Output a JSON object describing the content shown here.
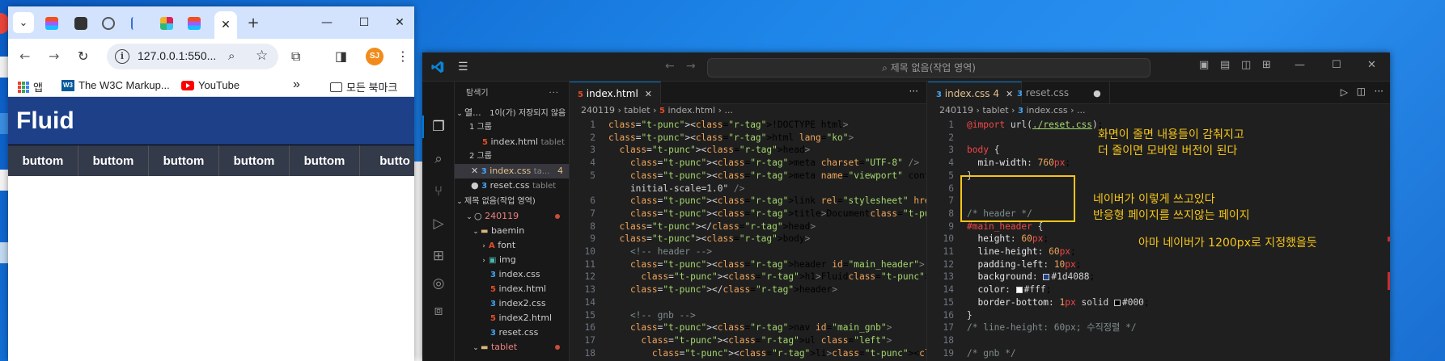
{
  "chrome": {
    "url": "127.0.0.1:550...",
    "avatar_initials": "SJ",
    "bookmarks": [
      "앱",
      "The W3C Markup...",
      "YouTube",
      "모든 북마크"
    ],
    "page": {
      "header_title": "Fluid",
      "nav_items": [
        "buttom",
        "buttom",
        "buttom",
        "buttom",
        "buttom",
        "butto"
      ]
    }
  },
  "vscode": {
    "command_center": "제목 없음(작업 영역)",
    "explorer": {
      "title": "탐색기",
      "open_editors_label": "열...",
      "unsaved": "1이(가) 저장되지 않음",
      "group1": "1 그룹",
      "group2": "2 그룹",
      "g1_file": "index.html",
      "g1_file_dir": "tablet",
      "g2_file1": "index.css",
      "g2_file1_dir": "ta...",
      "g2_file1_badge": "4",
      "g2_file2": "reset.css",
      "g2_file2_dir": "tablet",
      "workspace": "제목 없음(작업 영역)",
      "root": "240119",
      "folder_baemin": "baemin",
      "folder_font": "font",
      "folder_img": "img",
      "files": [
        "index.css",
        "index.html",
        "index2.css",
        "index2.html",
        "reset.css"
      ],
      "folder_tablet": "tablet"
    },
    "left_editor": {
      "tab": "index.html",
      "crumbs": [
        "240119",
        "tablet",
        "index.html",
        "..."
      ],
      "lines": [
        "<!DOCTYPE html>",
        "<html lang=\"ko\">",
        "  <head>",
        "    <meta charset=\"UTF-8\" />",
        "    <meta name=\"viewport\" content=\"width=device-width,",
        "    initial-scale=1.0\" />",
        "    <link rel=\"stylesheet\" href=\"./index.css\" />",
        "    <title>Document</title>",
        "  </head>",
        "  <body>",
        "    <!-- header -->",
        "    <header id=\"main_header\">",
        "      <h1>Fluid</h1>",
        "    </header>",
        "",
        "    <!-- gnb -->",
        "    <nav id=\"main_gnb\">",
        "      <ul class=\"left\">",
        "        <li><a href=\"#\">buttom</a></li>"
      ],
      "line_numbers": [
        "1",
        "2",
        "3",
        "4",
        "5",
        "",
        "6",
        "7",
        "8",
        "9",
        "10",
        "11",
        "12",
        "13",
        "14",
        "15",
        "16",
        "17",
        "18"
      ]
    },
    "right_editor": {
      "tab1": "index.css",
      "tab1_badge": "4",
      "tab2": "reset.css",
      "crumbs": [
        "240119",
        "tablet",
        "index.css",
        "..."
      ],
      "lines": [
        "@import url(./reset.css);",
        "",
        "body {",
        "  min-width: 760px;",
        "}",
        "",
        "",
        "/* header */",
        "#main_header {",
        "  height: 60px;",
        "  line-height: 60px;",
        "  padding-left: 10px;",
        "  background: #1d4088;",
        "  color: #fff;",
        "  border-bottom: 1px solid #000;",
        "}",
        "/* line-height: 60px; 수직정렬 */",
        "",
        "/* gnb */",
        "#main_gnb {"
      ]
    },
    "annotations": {
      "a1_line1": "화면이 줄면 내용들이 감춰지고",
      "a1_line2": "더 줄이면 모바일 버전이 된다",
      "a2_line1": "네이버가 이렇게 쓰고있다",
      "a2_line2": "반응형 페이지를 쓰지않는 페이지",
      "a3": "아마 네이버가 1200px로 지정했을듯"
    },
    "colors": {
      "header_bg": "#1d4088",
      "annotation": "#f5c518"
    }
  }
}
